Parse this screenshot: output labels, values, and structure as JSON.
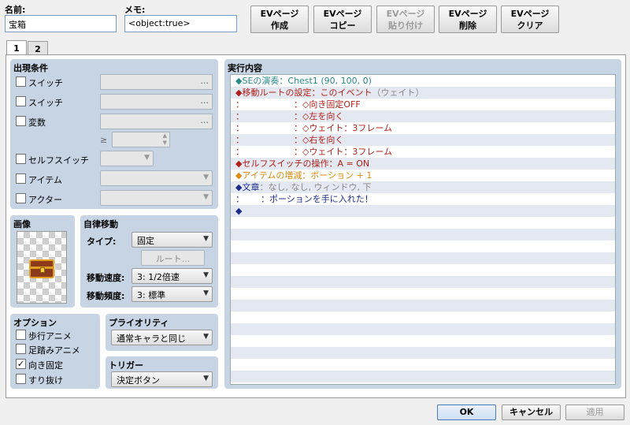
{
  "header": {
    "name_label": "名前:",
    "name_value": "宝箱",
    "memo_label": "メモ:",
    "memo_value": "<object:true>"
  },
  "toolbar": {
    "buttons": [
      {
        "line1": "EVページ",
        "line2": "作成"
      },
      {
        "line1": "EVページ",
        "line2": "コピー"
      },
      {
        "line1": "EVページ",
        "line2": "貼り付け"
      },
      {
        "line1": "EVページ",
        "line2": "削除"
      },
      {
        "line1": "EVページ",
        "line2": "クリア"
      }
    ]
  },
  "tabs": [
    "1",
    "2"
  ],
  "conditions": {
    "title": "出現条件",
    "switch1_label": "スイッチ",
    "switch2_label": "スイッチ",
    "variable_label": "変数",
    "ge_symbol": "≥",
    "selfswitch_label": "セルフスイッチ",
    "item_label": "アイテム",
    "actor_label": "アクター",
    "dots": "..."
  },
  "image": {
    "title": "画像"
  },
  "autonomous": {
    "title": "自律移動",
    "type_label": "タイプ:",
    "type_value": "固定",
    "route_button": "ルート...",
    "speed_label": "移動速度:",
    "speed_value": "3: 1/2倍速",
    "freq_label": "移動頻度:",
    "freq_value": "3: 標準"
  },
  "options": {
    "title": "オプション",
    "items": [
      {
        "label": "歩行アニメ",
        "checked": false
      },
      {
        "label": "足踏みアニメ",
        "checked": false
      },
      {
        "label": "向き固定",
        "checked": true
      },
      {
        "label": "すり抜け",
        "checked": false
      }
    ],
    "check_glyph": "✓"
  },
  "priority": {
    "title": "プライオリティ",
    "value": "通常キャラと同じ"
  },
  "trigger": {
    "title": "トリガー",
    "value": "決定ボタン"
  },
  "contents": {
    "title": "実行内容",
    "commands": [
      {
        "text": "◆SEの演奏：Chest1 (90, 100, 0)",
        "color": "teal"
      },
      {
        "text": "◆移動ルートの設定：このイベント",
        "suffix": "（ウェイト）",
        "color": "red"
      },
      {
        "text": "：                  ：◇向き固定OFF",
        "color": "red"
      },
      {
        "text": "：                  ：◇左を向く",
        "color": "red"
      },
      {
        "text": "：                  ：◇ウェイト：3フレーム",
        "color": "red"
      },
      {
        "text": "：                  ：◇右を向く",
        "color": "red"
      },
      {
        "text": "：                  ：◇ウェイト：3フレーム",
        "color": "red"
      },
      {
        "text": "◆セルフスイッチの操作：A = ON",
        "color": "red"
      },
      {
        "text": "◆アイテムの増減：ポーション + 1",
        "color": "orange"
      },
      {
        "text": "◆文章",
        "suffix": "：なし, なし, ウィンドウ, 下",
        "color": "navy"
      },
      {
        "text": "：      ：ポーションを手に入れた！",
        "color": "navy"
      },
      {
        "text": "◆",
        "color": "navy"
      }
    ]
  },
  "footer": {
    "ok": "OK",
    "cancel": "キャンセル",
    "apply": "適用"
  },
  "colors": {
    "group_bg": "#c6d4e4",
    "accent": "#4a7ab8"
  }
}
